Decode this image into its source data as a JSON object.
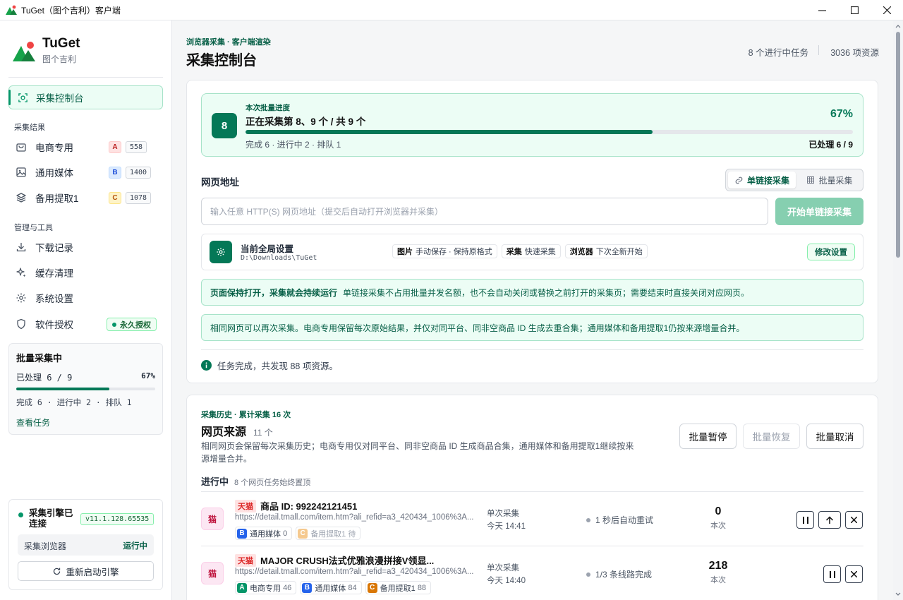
{
  "window": {
    "title": "TuGet（图个吉利）客户端"
  },
  "brand": {
    "name": "TuGet",
    "sub": "图个吉利"
  },
  "nav": {
    "active": "采集控制台",
    "results_label": "采集结果",
    "results": [
      {
        "label": "电商专用",
        "letter": "A",
        "count": "558"
      },
      {
        "label": "通用媒体",
        "letter": "B",
        "count": "1400"
      },
      {
        "label": "备用提取1",
        "letter": "C",
        "count": "1078"
      }
    ],
    "tools_label": "管理与工具",
    "tools": [
      {
        "label": "下载记录",
        "icon": "download-icon"
      },
      {
        "label": "缓存清理",
        "icon": "sparkle-icon"
      },
      {
        "label": "系统设置",
        "icon": "gear-icon"
      },
      {
        "label": "软件授权",
        "icon": "shield-icon"
      }
    ],
    "license_badge": "永久授权"
  },
  "batch_card": {
    "title": "批量采集中",
    "processed": "已处理 6 / 9",
    "percent": "67%",
    "progress": 0.67,
    "status": "完成 6 · 进行中 2 · 排队 1",
    "link": "查看任务"
  },
  "engine": {
    "status": "采集引擎已连接",
    "version": "v11.1.128.65535",
    "browser_label": "采集浏览器",
    "browser_status": "运行中",
    "restart": "重新启动引擎"
  },
  "header": {
    "eyebrow": "浏览器采集 · 客户端渲染",
    "title": "采集控制台",
    "tasks": "8 个进行中任务",
    "resources": "3036 项资源"
  },
  "progress": {
    "number": "8",
    "label": "本次批量进度",
    "title": "正在采集第 8、9 个 / 共 9 个",
    "percent": "67%",
    "value": 0.67,
    "status": "完成 6 · 进行中 2 · 排队 1",
    "processed": "已处理 6 / 9"
  },
  "url": {
    "label": "网页地址",
    "mode_single": "单链接采集",
    "mode_batch": "批量采集",
    "placeholder": "输入任意 HTTP(S) 网页地址（提交后自动打开浏览器并采集）",
    "submit": "开始单链接采集"
  },
  "settings": {
    "title": "当前全局设置",
    "path": "D:\\Downloads\\TuGet",
    "tags": [
      {
        "key": "图片",
        "value": "手动保存 · 保持原格式"
      },
      {
        "key": "采集",
        "value": "快速采集"
      },
      {
        "key": "浏览器",
        "value": "下次全新开始"
      }
    ],
    "edit": "修改设置"
  },
  "notices": {
    "n1_bold": "页面保持打开，采集就会持续运行",
    "n1_text": "单链接采集不占用批量并发名额，也不会自动关闭或替换之前打开的采集页；需要结束时直接关闭对应网页。",
    "n2_text": "相同网页可以再次采集。电商专用保留每次原始结果，并仅对同平台、同非空商品 ID 生成去重合集；通用媒体和备用提取1仍按来源增量合并。"
  },
  "status_line": "任务完成，共发现 88 项资源。",
  "history": {
    "eyebrow": "采集历史 · 累计采集 16 次",
    "title": "网页来源",
    "count": "11 个",
    "desc": "相同网页会保留每次采集历史；电商专用仅对同平台、同非空商品 ID 生成商品合集，通用媒体和备用提取1继续按来源增量合并。",
    "btn_pause": "批量暂停",
    "btn_resume": "批量恢复",
    "btn_cancel": "批量取消",
    "section": "进行中",
    "section_note": "8 个网页任务始终置顶",
    "rows": [
      {
        "badge": "猫",
        "platform": "天猫",
        "title": "商品 ID: 992242121451",
        "url": "https://detail.tmall.com/item.htm?ali_refid=a3_420434_1006%3A...",
        "tags": [
          {
            "letter": "B",
            "label": "通用媒体",
            "value": "0"
          },
          {
            "letter": "C",
            "label": "备用提取1",
            "value": "待"
          }
        ],
        "mode": "单次采集",
        "time": "今天 14:41",
        "state": "1 秒后自动重试",
        "count": "0",
        "count_label": "本次"
      },
      {
        "badge": "猫",
        "platform": "天猫",
        "title": "MAJOR CRUSH法式优雅浪漫拼接V领显...",
        "url": "https://detail.tmall.com/item.htm?ali_refid=a3_420434_1006%3A...",
        "tags": [
          {
            "letter": "A",
            "label": "电商专用",
            "value": "46"
          },
          {
            "letter": "B",
            "label": "通用媒体",
            "value": "84"
          },
          {
            "letter": "C",
            "label": "备用提取1",
            "value": "88"
          }
        ],
        "mode": "单次采集",
        "time": "今天 14:40",
        "state": "1/3 条线路完成",
        "count": "218",
        "count_label": "本次"
      }
    ]
  },
  "colors": {
    "accent": "#047857",
    "accent_light": "#ecfdf5",
    "tmall": "#dc2626"
  }
}
